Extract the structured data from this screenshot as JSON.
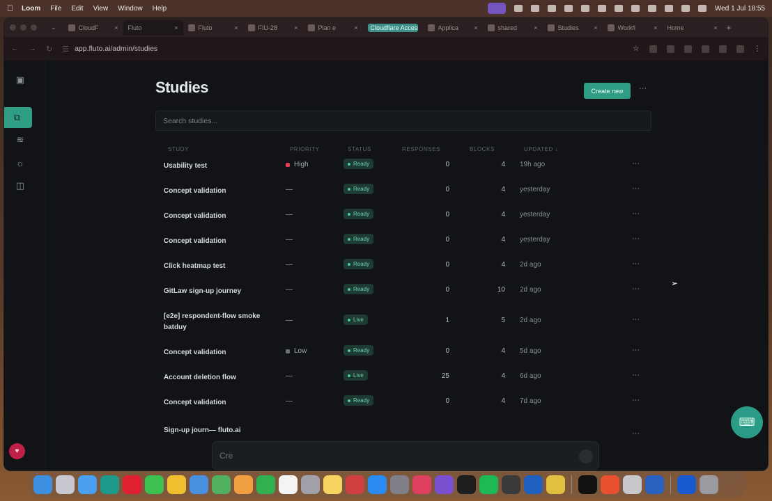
{
  "menubar": {
    "app_name": "Loom",
    "menus": [
      "File",
      "Edit",
      "View",
      "Window",
      "Help"
    ],
    "clock": "Wed 1 Jul  18:55"
  },
  "browser": {
    "tabs": [
      {
        "label": "CloudF"
      },
      {
        "label": "Fluto"
      },
      {
        "label": "Fluto"
      },
      {
        "label": "FIU-28"
      },
      {
        "label": "Plan e"
      },
      {
        "label": "Cloudflare Access"
      },
      {
        "label": "Applica"
      },
      {
        "label": "shared"
      },
      {
        "label": "Studies"
      },
      {
        "label": "Workfl"
      },
      {
        "label": "Home"
      }
    ],
    "url": "app.fluto.ai/admin/studies"
  },
  "page": {
    "title": "Studies",
    "create_label": "Create new",
    "more_label": "···",
    "search_placeholder": "Search studies...",
    "columns": {
      "study": "Study",
      "priority": "Priority",
      "status": "Status",
      "responses": "Responses",
      "blocks": "Blocks",
      "updated": "Updated ↓"
    },
    "rows": [
      {
        "study": "Usability test",
        "priority": "High",
        "priority_color": "#e0425a",
        "status": "Ready",
        "responses": "0",
        "blocks": "4",
        "updated": "19h ago"
      },
      {
        "study": "Concept validation",
        "priority": "—",
        "priority_color": "",
        "status": "Ready",
        "responses": "0",
        "blocks": "4",
        "updated": "yesterday"
      },
      {
        "study": "Concept validation",
        "priority": "—",
        "priority_color": "",
        "status": "Ready",
        "responses": "0",
        "blocks": "4",
        "updated": "yesterday"
      },
      {
        "study": "Concept validation",
        "priority": "—",
        "priority_color": "",
        "status": "Ready",
        "responses": "0",
        "blocks": "4",
        "updated": "yesterday"
      },
      {
        "study": "Click heatmap test",
        "priority": "—",
        "priority_color": "",
        "status": "Ready",
        "responses": "0",
        "blocks": "4",
        "updated": "2d ago"
      },
      {
        "study": "GitLaw sign-up journey",
        "priority": "—",
        "priority_color": "",
        "status": "Ready",
        "responses": "0",
        "blocks": "10",
        "updated": "2d ago"
      },
      {
        "study": "[e2e] respondent-flow smoke batduy",
        "priority": "—",
        "priority_color": "",
        "status": "Live",
        "responses": "1",
        "blocks": "5",
        "updated": "2d ago"
      },
      {
        "study": "Concept validation",
        "priority": "Low",
        "priority_color": "#6a7078",
        "status": "Ready",
        "responses": "0",
        "blocks": "4",
        "updated": "5d ago"
      },
      {
        "study": "Account deletion flow",
        "priority": "—",
        "priority_color": "",
        "status": "Live",
        "responses": "25",
        "blocks": "4",
        "updated": "6d ago"
      },
      {
        "study": "Concept validation",
        "priority": "—",
        "priority_color": "",
        "status": "Ready",
        "responses": "0",
        "blocks": "4",
        "updated": "7d ago"
      },
      {
        "study": "Sign-up journ— fluto.ai",
        "priority": "",
        "priority_color": "",
        "status": "",
        "responses": "",
        "blocks": "",
        "updated": ""
      }
    ],
    "chat_input_value": "Cre"
  },
  "colors": {
    "accent": "#2f9d84",
    "background": "#111316",
    "high_priority": "#e0425a"
  }
}
